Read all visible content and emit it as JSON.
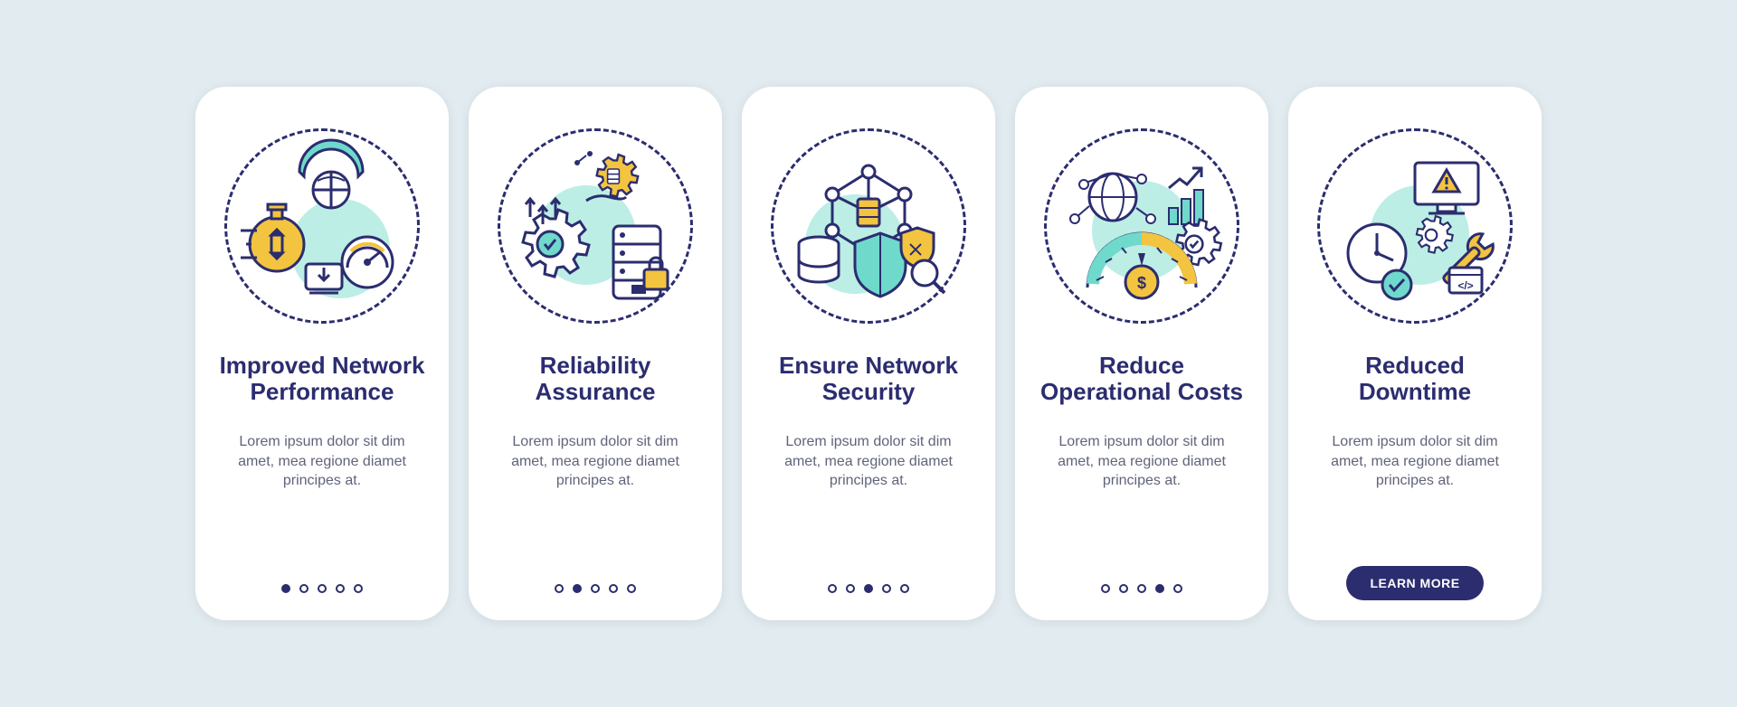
{
  "colors": {
    "primary": "#2b2d6f",
    "accent_yellow": "#f3c43f",
    "accent_teal": "#6fd9cc",
    "accent_mint_light": "#bceee5",
    "text_muted": "#60647a",
    "page_bg": "#e2ecf0",
    "card_bg": "#ffffff"
  },
  "cta_label": "LEARN MORE",
  "cards": [
    {
      "title": "Improved Network Performance",
      "body": "Lorem ipsum dolor sit dim amet, mea regione diamet principes at.",
      "icon_name": "network-performance-icon",
      "active_index": 0
    },
    {
      "title": "Reliability Assurance",
      "body": "Lorem ipsum dolor sit dim amet, mea regione diamet principes at.",
      "icon_name": "reliability-assurance-icon",
      "active_index": 1
    },
    {
      "title": "Ensure Network Security",
      "body": "Lorem ipsum dolor sit dim amet, mea regione diamet principes at.",
      "icon_name": "network-security-icon",
      "active_index": 2
    },
    {
      "title": "Reduce Operational Costs",
      "body": "Lorem ipsum dolor sit dim amet, mea regione diamet principes at.",
      "icon_name": "operational-costs-icon",
      "active_index": 3
    },
    {
      "title": "Reduced Downtime",
      "body": "Lorem ipsum dolor sit dim amet, mea regione diamet principes at.",
      "icon_name": "reduced-downtime-icon",
      "active_index": 4
    }
  ]
}
